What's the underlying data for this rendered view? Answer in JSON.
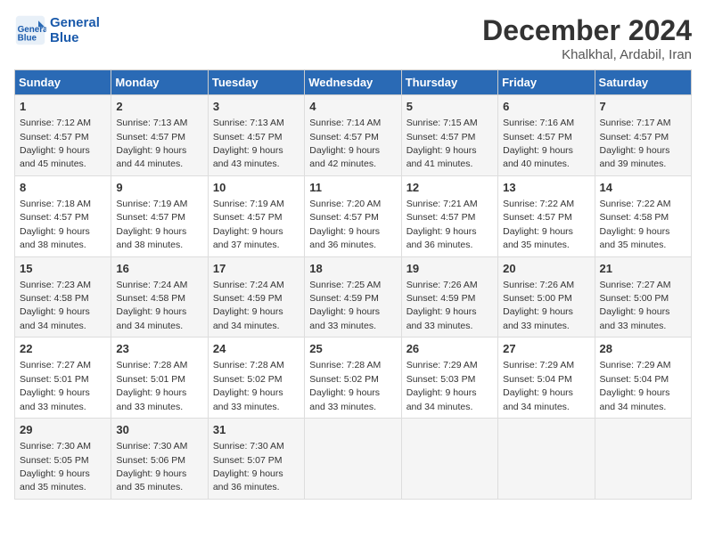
{
  "header": {
    "logo_line1": "General",
    "logo_line2": "Blue",
    "month": "December 2024",
    "location": "Khalkhal, Ardabil, Iran"
  },
  "days_of_week": [
    "Sunday",
    "Monday",
    "Tuesday",
    "Wednesday",
    "Thursday",
    "Friday",
    "Saturday"
  ],
  "weeks": [
    [
      {
        "day": 1,
        "sunrise": "7:12 AM",
        "sunset": "4:57 PM",
        "daylight": "9 hours and 45 minutes."
      },
      {
        "day": 2,
        "sunrise": "7:13 AM",
        "sunset": "4:57 PM",
        "daylight": "9 hours and 44 minutes."
      },
      {
        "day": 3,
        "sunrise": "7:13 AM",
        "sunset": "4:57 PM",
        "daylight": "9 hours and 43 minutes."
      },
      {
        "day": 4,
        "sunrise": "7:14 AM",
        "sunset": "4:57 PM",
        "daylight": "9 hours and 42 minutes."
      },
      {
        "day": 5,
        "sunrise": "7:15 AM",
        "sunset": "4:57 PM",
        "daylight": "9 hours and 41 minutes."
      },
      {
        "day": 6,
        "sunrise": "7:16 AM",
        "sunset": "4:57 PM",
        "daylight": "9 hours and 40 minutes."
      },
      {
        "day": 7,
        "sunrise": "7:17 AM",
        "sunset": "4:57 PM",
        "daylight": "9 hours and 39 minutes."
      }
    ],
    [
      {
        "day": 8,
        "sunrise": "7:18 AM",
        "sunset": "4:57 PM",
        "daylight": "9 hours and 38 minutes."
      },
      {
        "day": 9,
        "sunrise": "7:19 AM",
        "sunset": "4:57 PM",
        "daylight": "9 hours and 38 minutes."
      },
      {
        "day": 10,
        "sunrise": "7:19 AM",
        "sunset": "4:57 PM",
        "daylight": "9 hours and 37 minutes."
      },
      {
        "day": 11,
        "sunrise": "7:20 AM",
        "sunset": "4:57 PM",
        "daylight": "9 hours and 36 minutes."
      },
      {
        "day": 12,
        "sunrise": "7:21 AM",
        "sunset": "4:57 PM",
        "daylight": "9 hours and 36 minutes."
      },
      {
        "day": 13,
        "sunrise": "7:22 AM",
        "sunset": "4:57 PM",
        "daylight": "9 hours and 35 minutes."
      },
      {
        "day": 14,
        "sunrise": "7:22 AM",
        "sunset": "4:58 PM",
        "daylight": "9 hours and 35 minutes."
      }
    ],
    [
      {
        "day": 15,
        "sunrise": "7:23 AM",
        "sunset": "4:58 PM",
        "daylight": "9 hours and 34 minutes."
      },
      {
        "day": 16,
        "sunrise": "7:24 AM",
        "sunset": "4:58 PM",
        "daylight": "9 hours and 34 minutes."
      },
      {
        "day": 17,
        "sunrise": "7:24 AM",
        "sunset": "4:59 PM",
        "daylight": "9 hours and 34 minutes."
      },
      {
        "day": 18,
        "sunrise": "7:25 AM",
        "sunset": "4:59 PM",
        "daylight": "9 hours and 33 minutes."
      },
      {
        "day": 19,
        "sunrise": "7:26 AM",
        "sunset": "4:59 PM",
        "daylight": "9 hours and 33 minutes."
      },
      {
        "day": 20,
        "sunrise": "7:26 AM",
        "sunset": "5:00 PM",
        "daylight": "9 hours and 33 minutes."
      },
      {
        "day": 21,
        "sunrise": "7:27 AM",
        "sunset": "5:00 PM",
        "daylight": "9 hours and 33 minutes."
      }
    ],
    [
      {
        "day": 22,
        "sunrise": "7:27 AM",
        "sunset": "5:01 PM",
        "daylight": "9 hours and 33 minutes."
      },
      {
        "day": 23,
        "sunrise": "7:28 AM",
        "sunset": "5:01 PM",
        "daylight": "9 hours and 33 minutes."
      },
      {
        "day": 24,
        "sunrise": "7:28 AM",
        "sunset": "5:02 PM",
        "daylight": "9 hours and 33 minutes."
      },
      {
        "day": 25,
        "sunrise": "7:28 AM",
        "sunset": "5:02 PM",
        "daylight": "9 hours and 33 minutes."
      },
      {
        "day": 26,
        "sunrise": "7:29 AM",
        "sunset": "5:03 PM",
        "daylight": "9 hours and 34 minutes."
      },
      {
        "day": 27,
        "sunrise": "7:29 AM",
        "sunset": "5:04 PM",
        "daylight": "9 hours and 34 minutes."
      },
      {
        "day": 28,
        "sunrise": "7:29 AM",
        "sunset": "5:04 PM",
        "daylight": "9 hours and 34 minutes."
      }
    ],
    [
      {
        "day": 29,
        "sunrise": "7:30 AM",
        "sunset": "5:05 PM",
        "daylight": "9 hours and 35 minutes."
      },
      {
        "day": 30,
        "sunrise": "7:30 AM",
        "sunset": "5:06 PM",
        "daylight": "9 hours and 35 minutes."
      },
      {
        "day": 31,
        "sunrise": "7:30 AM",
        "sunset": "5:07 PM",
        "daylight": "9 hours and 36 minutes."
      },
      null,
      null,
      null,
      null
    ]
  ]
}
